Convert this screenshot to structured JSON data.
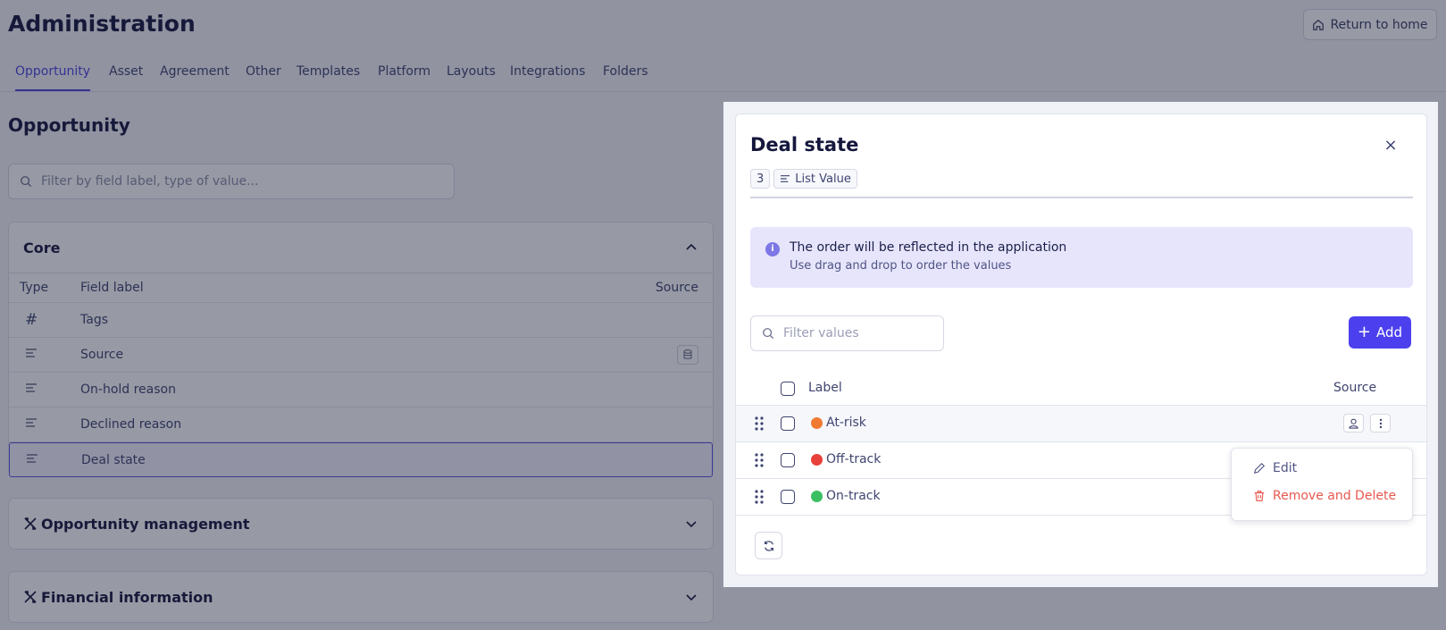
{
  "page": {
    "title": "Administration",
    "return_home_label": "Return to home",
    "tabs": [
      {
        "label": "Opportunity",
        "active": true
      },
      {
        "label": "Asset"
      },
      {
        "label": "Agreement"
      },
      {
        "label": "Other"
      },
      {
        "label": "Templates"
      },
      {
        "label": "Platform"
      },
      {
        "label": "Layouts"
      },
      {
        "label": "Integrations"
      },
      {
        "label": "Folders"
      }
    ],
    "section_title": "Opportunity",
    "search_placeholder": "Filter by field label, type of value..."
  },
  "core": {
    "title": "Core",
    "columns": {
      "type": "Type",
      "label": "Field label",
      "source": "Source"
    },
    "rows": [
      {
        "type_icon": "hash-icon",
        "label": "Tags"
      },
      {
        "type_icon": "list-icon",
        "label": "Source",
        "source_icon": "database-icon"
      },
      {
        "type_icon": "list-icon",
        "label": "On-hold reason"
      },
      {
        "type_icon": "list-icon",
        "label": "Declined reason"
      },
      {
        "type_icon": "list-icon",
        "label": "Deal state",
        "selected": true
      }
    ]
  },
  "groups": [
    {
      "title": "Opportunity management",
      "icon": "tools-icon"
    },
    {
      "title": "Financial information",
      "icon": "tools-icon"
    }
  ],
  "drawer": {
    "title": "Deal state",
    "count_badge": "3",
    "type_badge": "List Value",
    "info_title": "The order will be reflected in the application",
    "info_subtitle": "Use drag and drop to order the values",
    "filter_placeholder": "Filter values",
    "add_label": "Add",
    "columns": {
      "label": "Label",
      "source": "Source"
    },
    "values": [
      {
        "label": "At-risk",
        "color": "#f07a32"
      },
      {
        "label": "Off-track",
        "color": "#e8403a"
      },
      {
        "label": "On-track",
        "color": "#3cbf62"
      }
    ]
  },
  "context_menu": {
    "edit_label": "Edit",
    "delete_label": "Remove and Delete",
    "delete_color": "#e8584f"
  },
  "colors": {
    "accent": "#4c40ee",
    "overlay": "rgba(24,28,54,0.45)"
  }
}
